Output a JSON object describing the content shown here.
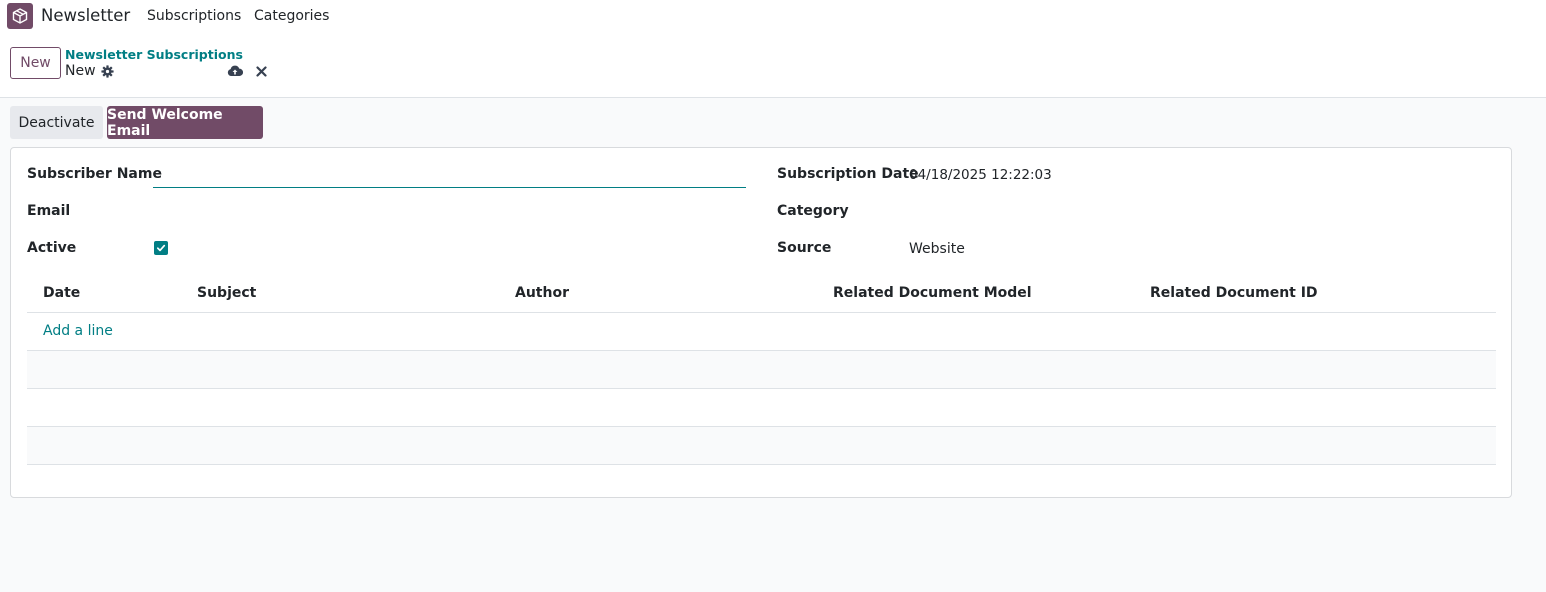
{
  "navbar": {
    "app_name": "Newsletter",
    "menu": [
      "Subscriptions",
      "Categories"
    ],
    "logo_icon": "box-icon"
  },
  "control_panel": {
    "new_button": "New",
    "breadcrumb_parent": "Newsletter Subscriptions",
    "breadcrumb_current": "New",
    "icons": [
      "gear-icon",
      "cloud-upload-icon",
      "close-icon"
    ]
  },
  "statusbar": {
    "deactivate_label": "Deactivate",
    "send_welcome_label": "Send Welcome Email"
  },
  "form": {
    "subscriber_name_label": "Subscriber Name",
    "subscriber_name_value": "",
    "email_label": "Email",
    "active_label": "Active",
    "active_checked": true,
    "subscription_date_label": "Subscription Date",
    "subscription_date_value": "04/18/2025 12:22:03",
    "category_label": "Category",
    "source_label": "Source",
    "source_value": "Website"
  },
  "table": {
    "columns": [
      "Date",
      "Subject",
      "Author",
      "Related Document Model",
      "Related Document ID"
    ],
    "add_line_label": "Add a line"
  },
  "colors": {
    "brand": "#714b67",
    "accent": "#017e84"
  }
}
